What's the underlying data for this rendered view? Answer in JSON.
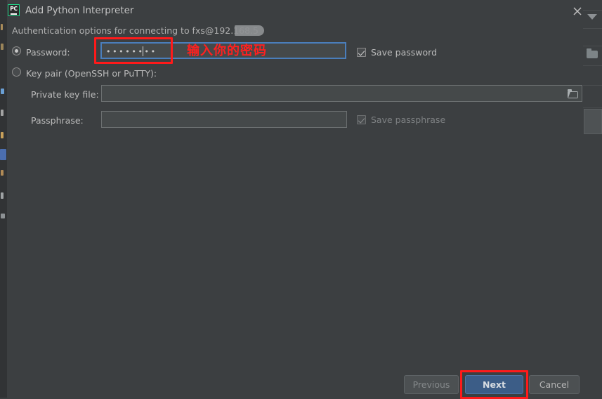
{
  "window": {
    "title": "Add Python Interpreter",
    "app_icon": "pycharm-pc-icon",
    "app_icon_text": "PC",
    "close_icon": "close-icon"
  },
  "subtitle": "Authentication options for connecting to fxs@192.168.5",
  "auth": {
    "password_option": {
      "label": "Password:",
      "selected": true,
      "value": "••••••••",
      "masked_char_count": 8
    },
    "keypair_option": {
      "label": "Key pair (OpenSSH or PuTTY):",
      "selected": false
    },
    "save_password": {
      "label": "Save password",
      "checked": true,
      "enabled": true
    },
    "private_key_file": {
      "label": "Private key file:",
      "value": "",
      "browse_icon": "folder-icon"
    },
    "passphrase": {
      "label": "Passphrase:",
      "value": ""
    },
    "save_passphrase": {
      "label": "Save passphrase",
      "checked": true,
      "enabled": false
    }
  },
  "annotations": {
    "password_field_note": "输入你的密码",
    "note_color": "#ff2020",
    "box_color": "#ff1a1a"
  },
  "footer": {
    "previous_label": "Previous",
    "next_label": "Next",
    "cancel_label": "Cancel"
  },
  "colors": {
    "dialog_background": "#3c3f41",
    "input_background": "#45494a",
    "focus_border": "#4a7ebb",
    "primary_button": "#3c5d87",
    "icon_accent": "#21d789"
  }
}
